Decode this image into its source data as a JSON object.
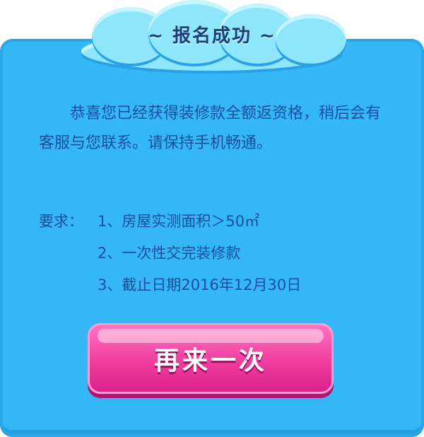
{
  "title": "~ 报名成功 ~",
  "message": "恭喜您已经获得装修款全额返资格，稍后会有客服与您联系。请保持手机畅通。",
  "requirements": {
    "label": "要求：",
    "items": [
      "1、房屋实测面积＞50㎡",
      "2、一次性交完装修款",
      "3、截止日期2016年12月30日"
    ]
  },
  "button_label": "再来一次",
  "colors": {
    "panel": "#35b6f5",
    "button": "#ef3d9f",
    "text": "#18509b"
  }
}
